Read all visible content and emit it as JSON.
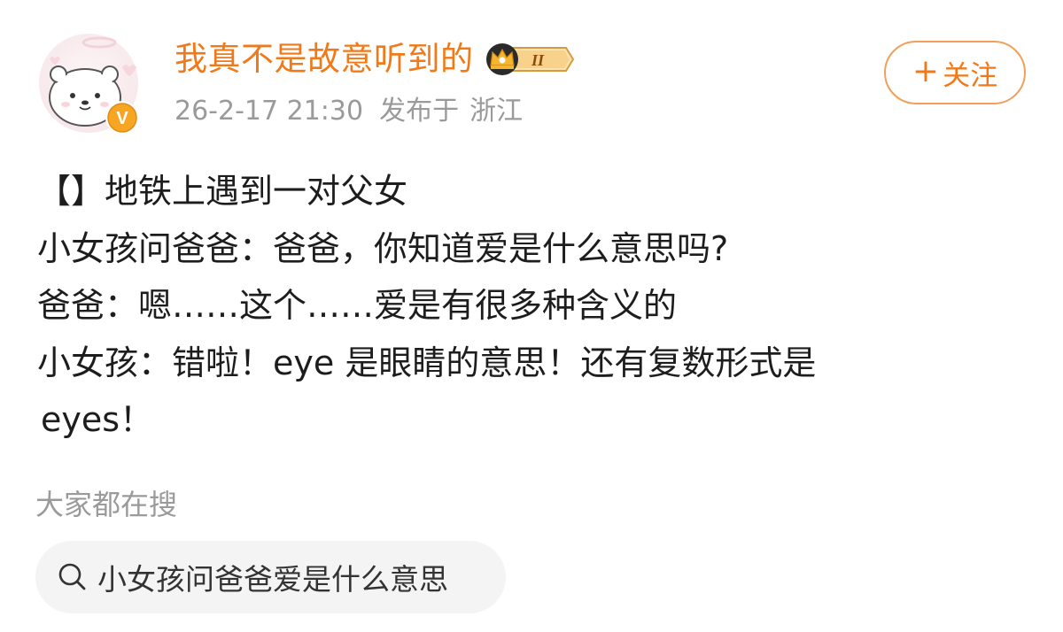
{
  "post": {
    "author": {
      "name": "我真不是故意听到的",
      "member_level": "II",
      "verified_mark": "V"
    },
    "meta": {
      "timestamp": "26-2-17 21:30",
      "published_label": "发布于",
      "location": "浙江"
    },
    "follow_button": {
      "label": "关注",
      "icon": "plus-icon"
    },
    "lines": [
      "【】地铁上遇到一对父女",
      "小女孩问爸爸：爸爸，你知道爱是什么意思吗?",
      "爸爸：嗯……这个……爱是有很多种含义的",
      "小女孩：错啦！eye 是眼睛的意思！还有复数形式是",
      "eyes！"
    ]
  },
  "trending": {
    "label": "大家都在搜",
    "items": [
      {
        "text": "小女孩问爸爸爱是什么意思",
        "icon": "search-icon"
      }
    ]
  },
  "colors": {
    "accent": "#f07a1a",
    "follow_border": "#f0a05a",
    "meta_text": "#9a9a9a",
    "chip_bg": "#f4f4f4",
    "body_text": "#1d1d1d"
  }
}
